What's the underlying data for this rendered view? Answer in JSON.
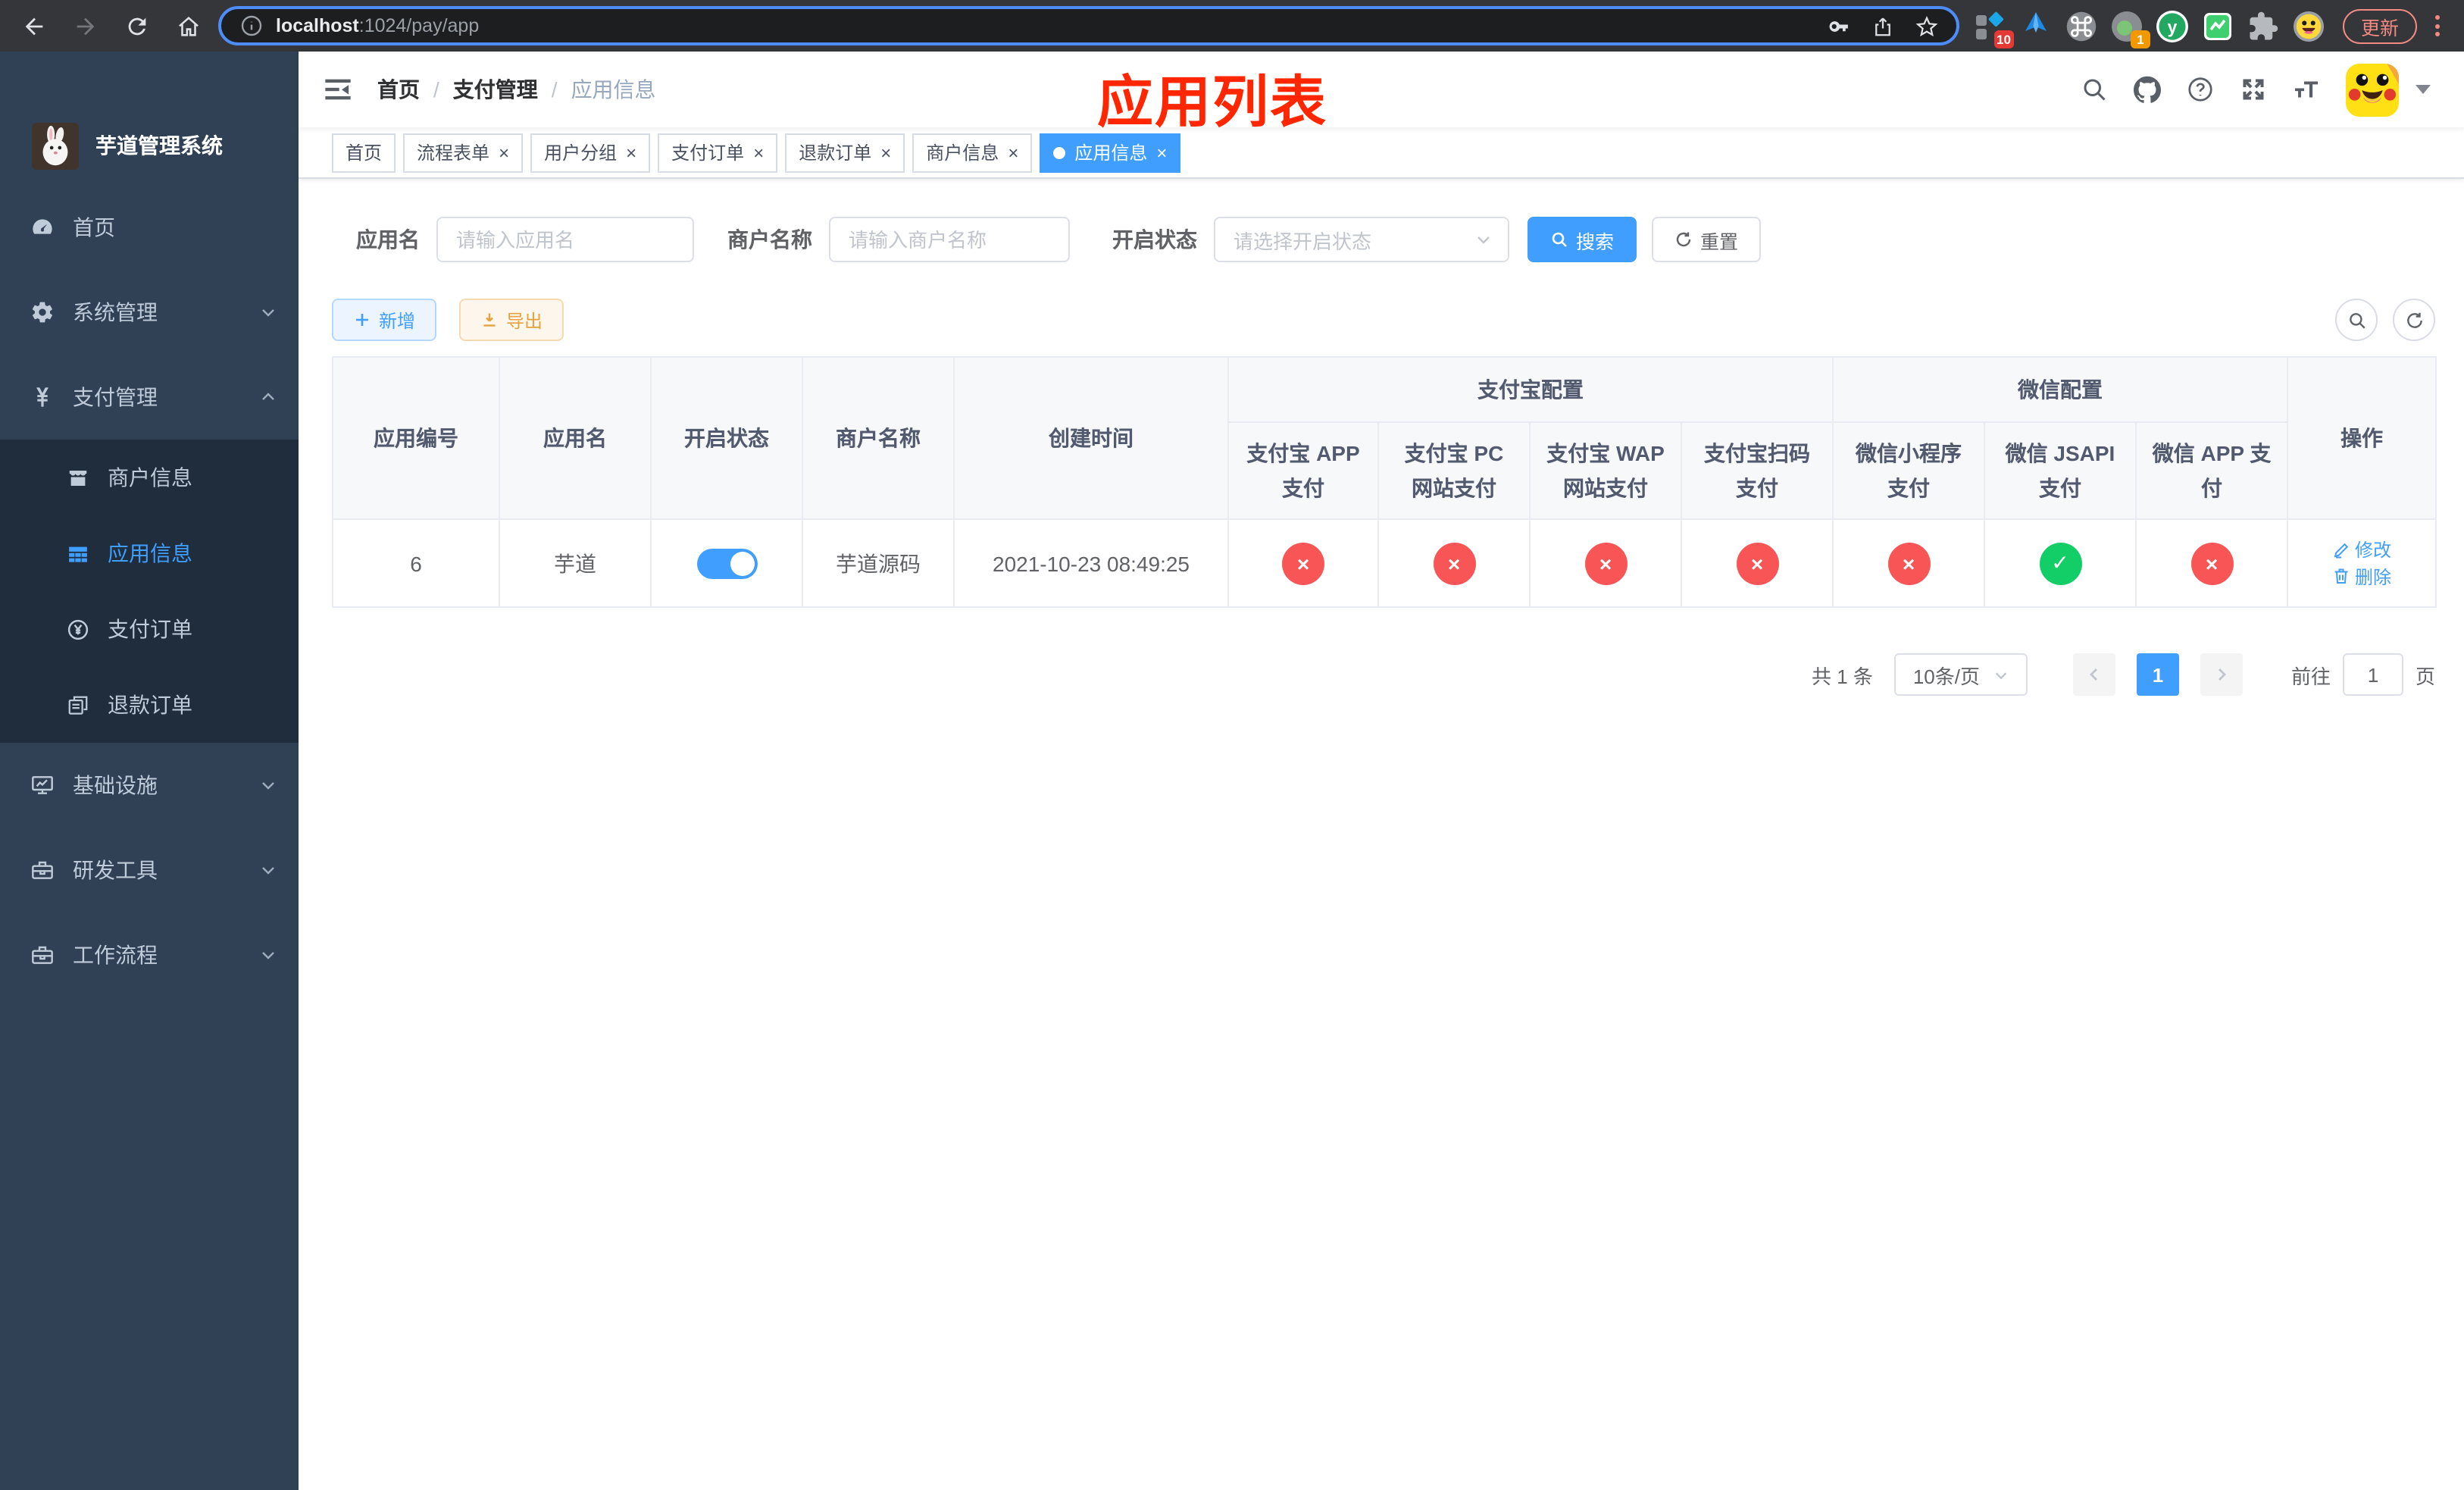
{
  "colors": {
    "accent": "#409eff",
    "danger": "#f85656",
    "success": "#13ce66",
    "warning": "#e6a23c",
    "annotation_red": "#ff2600"
  },
  "browser": {
    "url_host": "localhost",
    "url_rest": ":1024/pay/app",
    "update_label": "更新",
    "ext_badge_blocks": "10",
    "ext_badge_session": "1"
  },
  "annotation": {
    "title": "应用列表"
  },
  "sidebar": {
    "app_title": "芋道管理系统",
    "items": [
      {
        "label": "首页",
        "icon": "dashboard-icon"
      },
      {
        "label": "系统管理",
        "icon": "gear-icon",
        "chevron": "down"
      },
      {
        "label": "支付管理",
        "icon": "yen-icon",
        "chevron": "up"
      },
      {
        "label": "商户信息",
        "icon": "shop-icon",
        "sub": true
      },
      {
        "label": "应用信息",
        "icon": "grid-icon",
        "sub": true,
        "active": true
      },
      {
        "label": "支付订单",
        "icon": "coin-icon",
        "sub": true
      },
      {
        "label": "退款订单",
        "icon": "refund-icon",
        "sub": true
      },
      {
        "label": "基础设施",
        "icon": "monitor-icon",
        "chevron": "down"
      },
      {
        "label": "研发工具",
        "icon": "toolbox-icon",
        "chevron": "down"
      },
      {
        "label": "工作流程",
        "icon": "briefcase-icon",
        "chevron": "down"
      }
    ]
  },
  "navbar": {
    "breadcrumb": [
      "首页",
      "支付管理",
      "应用信息"
    ],
    "separator": "/"
  },
  "tabs": [
    {
      "label": "首页",
      "closable": false
    },
    {
      "label": "流程表单",
      "closable": true
    },
    {
      "label": "用户分组",
      "closable": true
    },
    {
      "label": "支付订单",
      "closable": true
    },
    {
      "label": "退款订单",
      "closable": true
    },
    {
      "label": "商户信息",
      "closable": true
    },
    {
      "label": "应用信息",
      "closable": true,
      "active": true
    }
  ],
  "filters": {
    "app_name_label": "应用名",
    "app_name_placeholder": "请输入应用名",
    "merchant_label": "商户名称",
    "merchant_placeholder": "请输入商户名称",
    "status_label": "开启状态",
    "status_placeholder": "请选择开启状态",
    "search_label": "搜索",
    "reset_label": "重置"
  },
  "toolbar": {
    "add_label": "新增",
    "export_label": "导出"
  },
  "table": {
    "columns": [
      "应用编号",
      "应用名",
      "开启状态",
      "商户名称",
      "创建时间"
    ],
    "group_alipay": "支付宝配置",
    "group_wechat": "微信配置",
    "alipay_columns": [
      "支付宝 APP 支付",
      "支付宝 PC 网站支付",
      "支付宝 WAP 网站支付",
      "支付宝扫码支付"
    ],
    "wechat_columns": [
      "微信小程序支付",
      "微信 JSAPI 支付",
      "微信 APP 支付"
    ],
    "actions_column": "操作",
    "action_edit": "修改",
    "action_delete": "删除",
    "rows": [
      {
        "app_id": "6",
        "app_name": "芋道",
        "enabled": true,
        "merchant": "芋道源码",
        "created_at": "2021-10-23 08:49:25",
        "configs": [
          false,
          false,
          false,
          false,
          false,
          true,
          false
        ]
      }
    ]
  },
  "pagination": {
    "total": "共 1 条",
    "page_size": "10条/页",
    "current_page": "1",
    "goto_label": "前往",
    "goto_value": "1",
    "page_unit": "页"
  }
}
